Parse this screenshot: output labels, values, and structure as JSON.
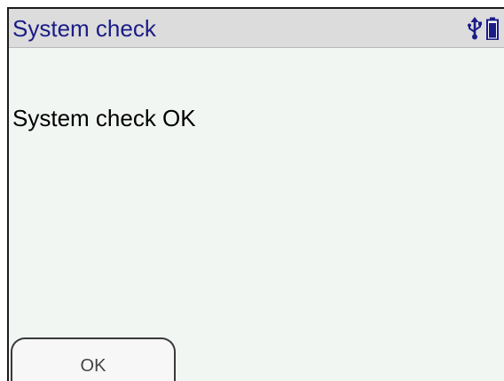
{
  "titlebar": {
    "title": "System check",
    "title_color": "#1b1c86",
    "icons": [
      "usb-icon",
      "battery-icon"
    ]
  },
  "main": {
    "message": "System check OK"
  },
  "softkeys": {
    "ok_label": "OK"
  },
  "colors": {
    "titlebar_bg": "#dcdcdc",
    "screen_bg": "#f1f6f3",
    "icon_blue": "#1b1c86"
  }
}
